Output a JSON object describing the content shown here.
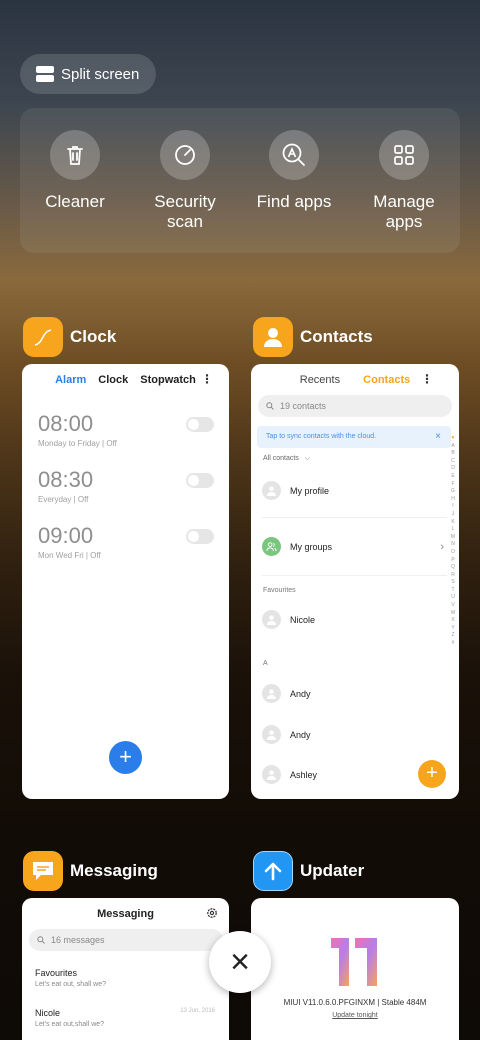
{
  "split_screen": {
    "label": "Split screen"
  },
  "quick_actions": [
    {
      "label": "Cleaner",
      "icon": "trash-icon"
    },
    {
      "label": "Security\nscan",
      "icon": "gauge-icon"
    },
    {
      "label": "Find apps",
      "icon": "find-apps-icon"
    },
    {
      "label": "Manage\napps",
      "icon": "grid-icon"
    }
  ],
  "apps": {
    "clock": {
      "name": "Clock",
      "icon_color": "#f7a51c",
      "tabs": [
        "Alarm",
        "Clock",
        "Stopwatch"
      ],
      "active_tab": "Alarm",
      "alarms": [
        {
          "time": "08:00",
          "repeat": "Monday to Friday | Off"
        },
        {
          "time": "08:30",
          "repeat": "Everyday | Off"
        },
        {
          "time": "09:00",
          "repeat": "Mon Wed Fri | Off"
        }
      ],
      "fab": "+"
    },
    "contacts": {
      "name": "Contacts",
      "icon_color": "#f7a51c",
      "tabs": [
        "Recents",
        "Contacts"
      ],
      "active_tab": "Contacts",
      "search_placeholder": "19 contacts",
      "sync_banner": "Tap to sync contacts with the cloud.",
      "filter": "All contacts",
      "rows": {
        "profile": "My profile",
        "groups": "My groups",
        "favourites_label": "Favourites",
        "fav1": "Nicole",
        "section_a": "A",
        "a1": "Andy",
        "a2": "Andy",
        "a3": "Ashley"
      },
      "alphabet": "ABCDEFGHIJKLMNOPQRSTUVWXYZ#",
      "fab": "+"
    },
    "messaging": {
      "name": "Messaging",
      "icon_color": "#f7a51c",
      "title": "Messaging",
      "search_placeholder": "16 messages",
      "threads": [
        {
          "name": "Favourites",
          "preview": "Let's eat out, shall we?",
          "date": ""
        },
        {
          "name": "Nicole",
          "preview": "Let's eat out,shall we?",
          "date": "13 Jun, 2016"
        }
      ]
    },
    "updater": {
      "name": "Updater",
      "icon_color": "#2196f3",
      "version": "MIUI V11.0.6.0.PFGINXM | Stable 484M",
      "link": "Update tonight"
    }
  },
  "close_label": "×"
}
